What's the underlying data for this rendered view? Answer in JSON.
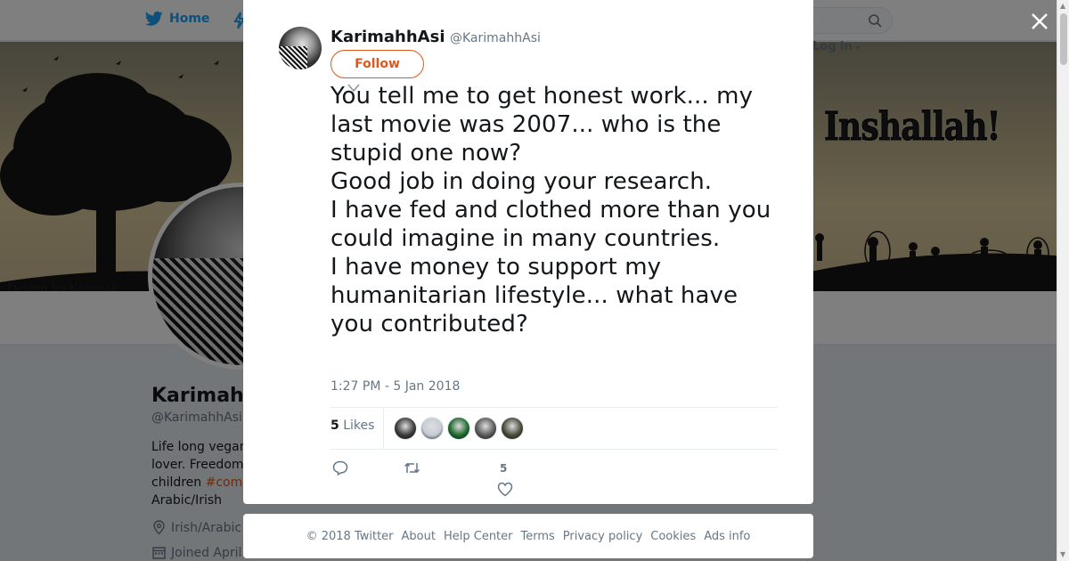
{
  "nav": {
    "home_label": "Home",
    "login_label": "Log in"
  },
  "banner": {
    "headline": "Inshallah!",
    "credit": "Design by Karimah"
  },
  "profile": {
    "name": "KarimahhAsi",
    "handle": "@KarimahhAsi",
    "bio_1": "Life long vegan",
    "bio_2": "lover. Freedom",
    "bio_3": "children",
    "bio_hashtag": "#com",
    "bio_4": "Arabic/Irish",
    "location": "Irish/Arabic",
    "joined": "Joined April"
  },
  "tweet": {
    "author_name": "KarimahhAsi",
    "author_handle": "@KarimahhAsi",
    "follow_label": "Follow",
    "text_lines": [
      "You tell me to get honest work... my last movie was 2007... who is the stupid one now?",
      "Good job in doing your research.",
      "I have fed and clothed more than you could imagine in many countries.",
      "I have money to support my humanitarian lifestyle... what have you contributed?"
    ],
    "timestamp": "1:27 PM - 5 Jan 2018",
    "likes_count": "5",
    "likes_label": "Likes",
    "like_action_count": "5",
    "liker_colors": [
      "#3a3a3a",
      "#c7ccd6",
      "#1f6b2e",
      "#5a5a5a",
      "#4a4a3a"
    ]
  },
  "footer": {
    "links": [
      "© 2018 Twitter",
      "About",
      "Help Center",
      "Terms",
      "Privacy policy",
      "Cookies",
      "Ads info"
    ]
  },
  "colors": {
    "brand_blue": "#1da1f2",
    "accent_orange": "#e0561a"
  }
}
